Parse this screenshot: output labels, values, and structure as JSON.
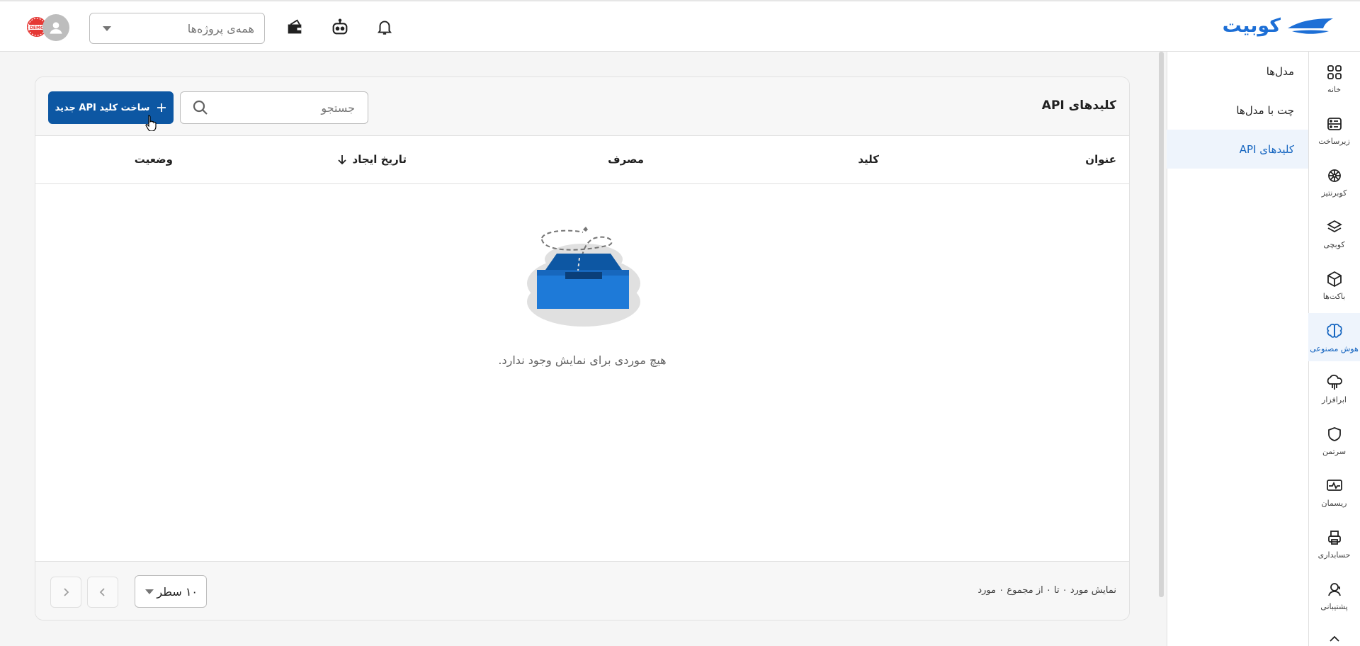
{
  "brand": {
    "name": "کوبیت"
  },
  "topbar": {
    "project_select_placeholder": "همه‌ی پروژه‌ها",
    "avatar_badge_text": "DEMO"
  },
  "rail": {
    "items": [
      {
        "label": "خانه",
        "icon": "home-grid-icon"
      },
      {
        "label": "زیرساخت",
        "icon": "server-icon"
      },
      {
        "label": "کوبرنتیز",
        "icon": "kubernetes-icon"
      },
      {
        "label": "کوبچی",
        "icon": "layers-icon"
      },
      {
        "label": "باکت‌ها",
        "icon": "box-icon"
      },
      {
        "label": "هوش مصنوعی",
        "icon": "brain-icon",
        "active": true
      },
      {
        "label": "ابرافزار",
        "icon": "cloud-app-icon"
      },
      {
        "label": "سرتمن",
        "icon": "shield-icon"
      },
      {
        "label": "ریسمان",
        "icon": "monitor-pulse-icon"
      },
      {
        "label": "حسابداری",
        "icon": "printer-icon"
      },
      {
        "label": "پشتیبانی",
        "icon": "support-icon"
      }
    ]
  },
  "subnav": {
    "items": [
      {
        "label": "مدل‌ها"
      },
      {
        "label": "چت با مدل‌ها"
      },
      {
        "label": "کلیدهای API",
        "active": true
      }
    ]
  },
  "page": {
    "title": "کلیدهای API",
    "search_placeholder": "جستجو",
    "create_button": "ساخت کلید API جدید",
    "columns": [
      "عنوان",
      "کلید",
      "مصرف",
      "تاریخ ایجاد",
      "وضعیت"
    ],
    "empty_message": "هیچ موردی برای نمایش وجود ندارد.",
    "footer_info": "نمایش مورد ۰ تا ۰ از مجموع ۰ مورد",
    "rows_per_page": "۱۰ سطر"
  },
  "colors": {
    "accent": "#1565c0",
    "button": "#0d57a3",
    "active_bg": "#eef4fc"
  }
}
